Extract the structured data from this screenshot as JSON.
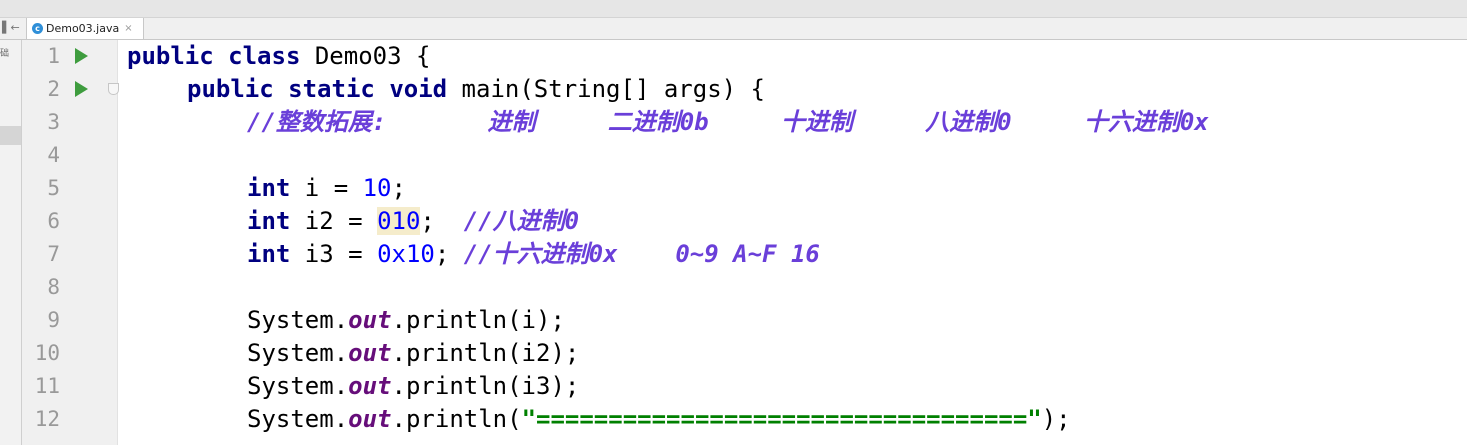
{
  "tab": {
    "icon_letter": "c",
    "filename": "Demo03.java",
    "close": "×"
  },
  "left_strip": {
    "label": "础",
    "pin_icon": "▌←"
  },
  "line_numbers": [
    "1",
    "2",
    "3",
    "4",
    "5",
    "6",
    "7",
    "8",
    "9",
    "10",
    "11",
    "12"
  ],
  "code": {
    "l1": {
      "kw1": "public",
      "kw2": "class",
      "rest": " Demo03 {"
    },
    "l2": {
      "kw1": "public",
      "kw2": "static",
      "kw3": "void",
      "rest": " main(String[] args) {"
    },
    "l3": {
      "comment": "//整数拓展:       进制     二进制0b     十进制     八进制0     十六进制0x"
    },
    "l5": {
      "kw": "int",
      "mid": " i = ",
      "num": "10",
      "end": ";"
    },
    "l6": {
      "kw": "int",
      "mid": " i2 = ",
      "num": "010",
      "end": ";  ",
      "comment": "//八进制0"
    },
    "l7": {
      "kw": "int",
      "mid": " i3 = ",
      "num": "0x10",
      "end": "; ",
      "comment": "//十六进制0x    0~9 A~F 16"
    },
    "l9": {
      "pre": "System.",
      "field": "out",
      "post": ".println(i);"
    },
    "l10": {
      "pre": "System.",
      "field": "out",
      "post": ".println(i2);"
    },
    "l11": {
      "pre": "System.",
      "field": "out",
      "post": ".println(i3);"
    },
    "l12": {
      "pre": "System.",
      "field": "out",
      "mid": ".println(",
      "str": "\"==================================\"",
      "post": ");"
    }
  }
}
